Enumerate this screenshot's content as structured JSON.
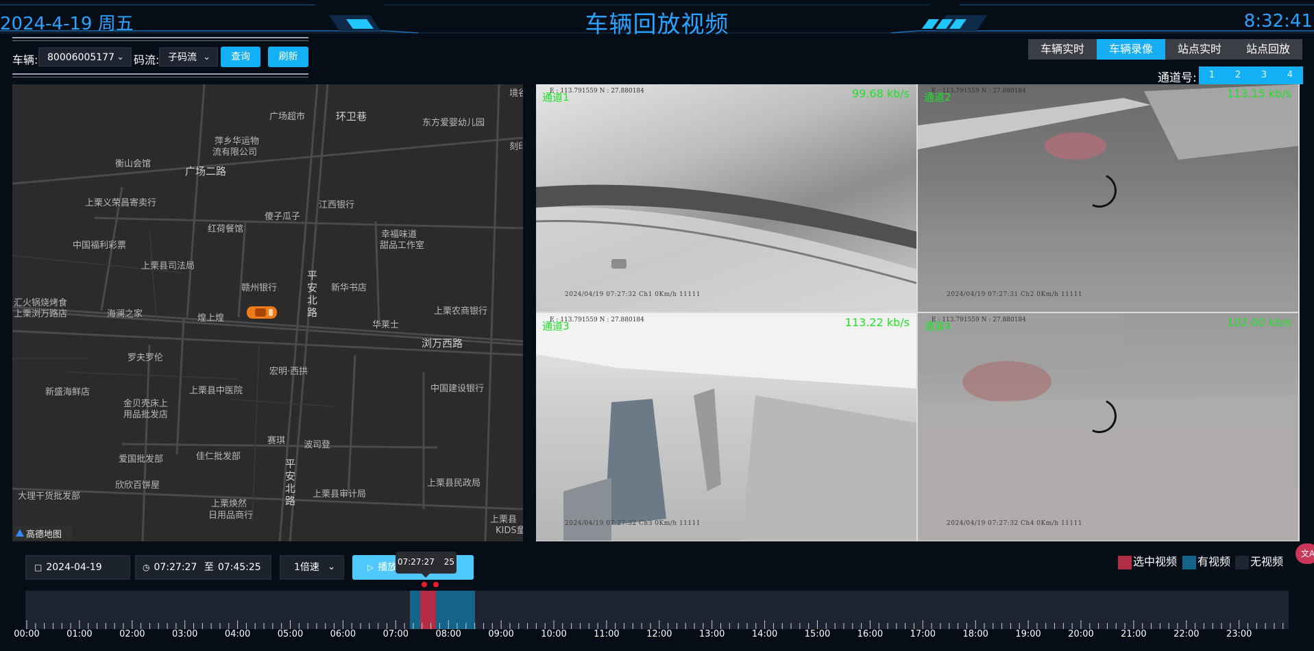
{
  "header": {
    "date": "2024-4-19 周五",
    "title": "车辆回放视频",
    "clock": "8:32:41",
    "accent": "#29a3ff"
  },
  "toolbar": {
    "vehicle_label": "车辆:",
    "vehicle_value": "80006005177",
    "stream_label": "码流:",
    "stream_value": "子码流",
    "query_label": "查询",
    "refresh_label": "刷新"
  },
  "tabs": [
    {
      "label": "车辆实时",
      "active": false
    },
    {
      "label": "车辆录像",
      "active": true
    },
    {
      "label": "站点实时",
      "active": false
    },
    {
      "label": "站点回放",
      "active": false
    }
  ],
  "channel_selector": {
    "label": "通道号:",
    "options": [
      "1",
      "2",
      "3",
      "4"
    ]
  },
  "map": {
    "labels": [
      "广场超市",
      "环卫巷",
      "东方爱婴幼儿园",
      "萍乡华运物",
      "流有限公司",
      "衡山会馆",
      "广场二路",
      "上栗义荣昌寄卖行",
      "江西银行",
      "傻子瓜子",
      "红荷餐馆",
      "幸福味道",
      "甜品工作室",
      "中国福利彩票",
      "上栗县司法局",
      "赣州银行",
      "新华书店",
      "平",
      "安",
      "北",
      "路",
      "汇火锅烧烤食",
      "上栗浏万路店",
      "海澜之家",
      "煌上煌",
      "华莱士",
      "上栗农商银行",
      "浏万西路",
      "罗夫罗伦",
      "宏明·西拱",
      "新盛海鲜店",
      "上栗县中医院",
      "中国建设银行",
      "金贝壳床上",
      "用品批发店",
      "赛琪",
      "波司登",
      "爱国批发部",
      "佳仁批发部",
      "欣欣百饼屋",
      "上栗县审计局",
      "上栗县民政局",
      "大理干货批发部",
      "上栗焕然",
      "日用品商行",
      "上栗县",
      "KIDS童",
      "境谷",
      "刻印",
      "高德地图"
    ],
    "brand": "高德地图"
  },
  "videos": [
    {
      "channel": "通道1",
      "rate": "99.68 kb/s",
      "gps": "E : 113.791559    N : 27.880184",
      "stamp": "2024/04/19   07:27:32   Ch1      0Km/h   11111"
    },
    {
      "channel": "通道2",
      "rate": "113.15 kb/s",
      "gps": "E : 113.791559    N : 27.880184",
      "stamp": "2024/04/19   07:27:31   Ch2      0Km/h   11111"
    },
    {
      "channel": "通道3",
      "rate": "113.22 kb/s",
      "gps": "E : 113.791559    N : 27.880184",
      "stamp": "2024/04/19   07:27:32   Ch3      0Km/h   11111"
    },
    {
      "channel": "通道4",
      "rate": "102.00 kb/s",
      "gps": "E : 113.791559    N : 27.880184",
      "stamp": "2024/04/19   07:27:32   Ch4      0Km/h   11111"
    }
  ],
  "controls": {
    "date": "2024-04-19",
    "time_start": "07:27:27",
    "time_sep": "至",
    "time_end": "07:45:25",
    "speed": "1倍速",
    "play_label": "播放",
    "tooltip_time": "07:27:27",
    "tooltip_extra": "25"
  },
  "legend": [
    {
      "label": "选中视频",
      "color": "#b22d45"
    },
    {
      "label": "有视频",
      "color": "#14648a"
    },
    {
      "label": "无视频",
      "color": "#1e2530"
    }
  ],
  "timeline": {
    "hours": [
      "00:00",
      "01:00",
      "02:00",
      "03:00",
      "04:00",
      "05:00",
      "06:00",
      "07:00",
      "08:00",
      "09:00",
      "10:00",
      "11:00",
      "12:00",
      "13:00",
      "14:00",
      "15:00",
      "16:00",
      "17:00",
      "18:00",
      "19:00",
      "20:00",
      "21:00",
      "22:00",
      "23:00"
    ],
    "has_video_start": "07:27",
    "has_video_end": "08:30",
    "selected_start": "07:27:27",
    "selected_end": "07:45:25"
  },
  "chart_data": {
    "type": "bar",
    "title": "",
    "series": [
      {
        "name": "有视频",
        "start_hour": 7.27,
        "end_hour": 8.5,
        "color": "#14648a"
      },
      {
        "name": "选中视频",
        "start_hour": 7.458,
        "end_hour": 7.757,
        "color": "#b22d45"
      }
    ],
    "xlim": [
      0,
      24
    ]
  }
}
